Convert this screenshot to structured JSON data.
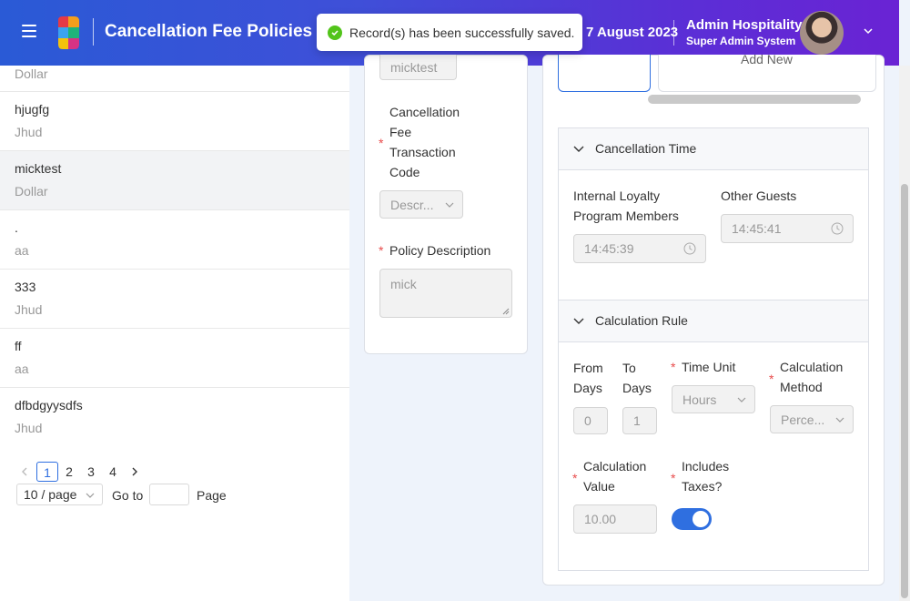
{
  "header": {
    "title": "Cancellation Fee Policies",
    "date": "7 August 2023",
    "user_name": "Admin Hospitality",
    "user_role": "Super Admin System"
  },
  "toast": {
    "message": "Record(s) has been successfully saved."
  },
  "records": [
    {
      "name": "",
      "sub": "Dollar"
    },
    {
      "name": "hjugfg",
      "sub": "Jhud"
    },
    {
      "name": "micktest",
      "sub": "Dollar"
    },
    {
      "name": ".",
      "sub": "aa"
    },
    {
      "name": "333",
      "sub": "Jhud"
    },
    {
      "name": "ff",
      "sub": "aa"
    },
    {
      "name": "dfbdgyysdfs",
      "sub": "Jhud"
    }
  ],
  "pagination": {
    "pages": [
      "1",
      "2",
      "3",
      "4"
    ],
    "current": "1",
    "page_size": "10 / page",
    "goto_label": "Go to",
    "page_label": "Page"
  },
  "form": {
    "top_field_value": "micktest",
    "transaction_code_label": "Cancellation Fee Transaction Code",
    "transaction_code_value": "Descr...",
    "policy_description_label": "Policy Description",
    "policy_description_value": "mick"
  },
  "tabs": {
    "second_label": "Add New"
  },
  "cancellation_time": {
    "title": "Cancellation Time",
    "internal_label": "Internal Loyalty Program Members",
    "internal_value": "14:45:39",
    "other_label": "Other Guests",
    "other_value": "14:45:41"
  },
  "calculation_rule": {
    "title": "Calculation Rule",
    "from_days_label": "From Days",
    "from_days_value": "0",
    "to_days_label": "To Days",
    "to_days_value": "1",
    "time_unit_label": "Time Unit",
    "time_unit_value": "Hours",
    "method_label": "Calculation Method",
    "method_value": "Perce...",
    "value_label": "Calculation Value",
    "value_value": "10.00",
    "taxes_label": "Includes Taxes?",
    "taxes_on": true
  },
  "colors": {
    "accent": "#2f6fe0",
    "required": "#e84b4b",
    "success": "#52c41a"
  }
}
